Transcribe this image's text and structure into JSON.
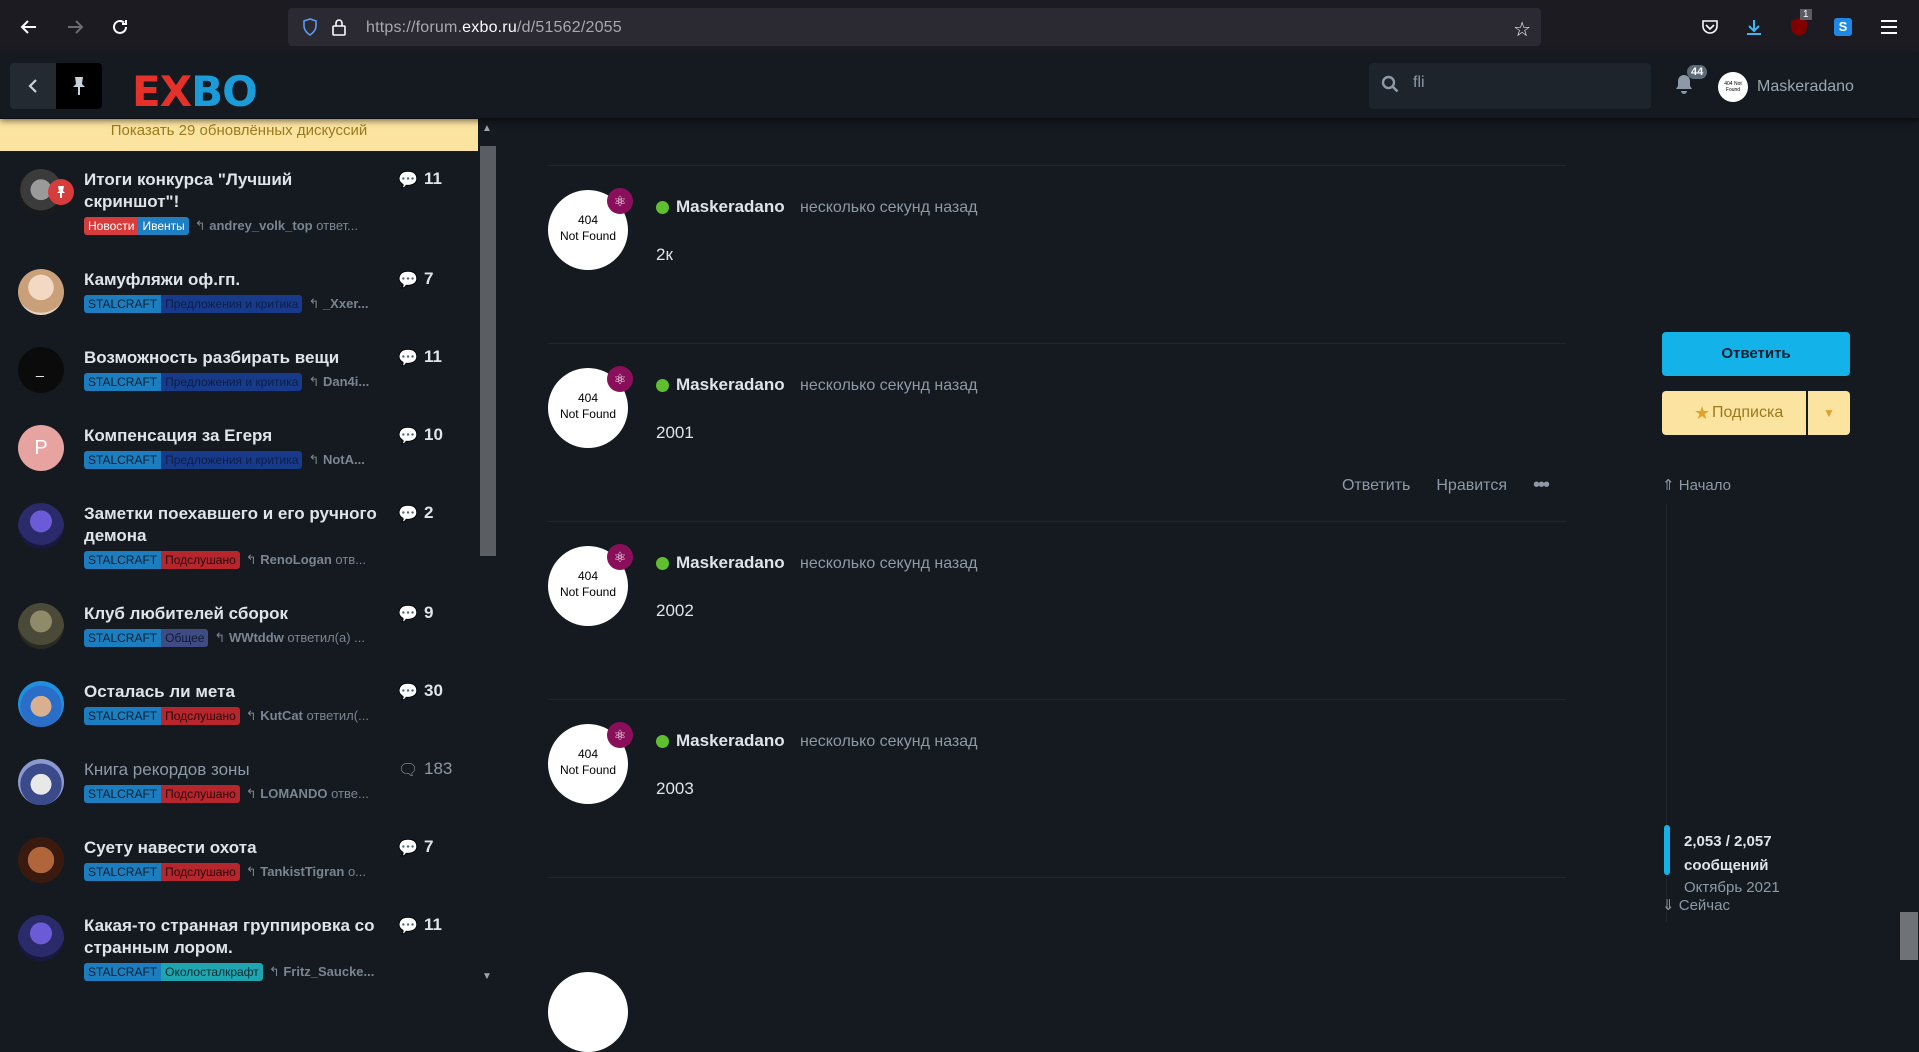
{
  "browser": {
    "url_prefix": "https://forum.",
    "url_domain": "exbo.ru",
    "url_path": "/d/51562/2055",
    "ext_badge": "1"
  },
  "header": {
    "logo_e": "E",
    "logo_x": "X",
    "logo_bo": "BO",
    "search_value": "fli",
    "notif_count": "44",
    "avatar_text": "404 Not Found",
    "username": "Maskeradano"
  },
  "sidebar": {
    "banner": "Показать 29 обновлённых дискуссий",
    "discussions": [
      {
        "title": "Итоги конкурса \"Лучший скриншот\"!",
        "count": "11",
        "tag1": "Новости",
        "tag2": "Ивенты",
        "reply_user": "andrey_volk_top",
        "reply_text": " ответ..."
      },
      {
        "title": "Камуфляжи оф.гп.",
        "count": "7",
        "tag1": "STALCRAFT",
        "tag2": "Предложения и критика",
        "reply_user": "_Xxer...",
        "reply_text": ""
      },
      {
        "title": "Возможность разбирать вещи",
        "count": "11",
        "tag1": "STALCRAFT",
        "tag2": "Предложения и критика",
        "reply_user": "Dan4i...",
        "reply_text": ""
      },
      {
        "title": "Компенсация за Егеря",
        "count": "10",
        "tag1": "STALCRAFT",
        "tag2": "Предложения и критика",
        "reply_user": "NotA...",
        "reply_text": ""
      },
      {
        "title": "Заметки поехавшего и его ручного демона",
        "count": "2",
        "tag1": "STALCRAFT",
        "tag2": "Подслушано",
        "reply_user": "RenoLogan",
        "reply_text": " отв..."
      },
      {
        "title": "Клуб любителей сборок",
        "count": "9",
        "tag1": "STALCRAFT",
        "tag2": "Общее",
        "reply_user": "WWtddw",
        "reply_text": " ответил(а) ..."
      },
      {
        "title": "Осталась ли мета",
        "count": "30",
        "tag1": "STALCRAFT",
        "tag2": "Подслушано",
        "reply_user": "KutCat",
        "reply_text": " ответил(..."
      },
      {
        "title": "Книга рекордов зоны",
        "count": "183",
        "tag1": "STALCRAFT",
        "tag2": "Подслушано",
        "reply_user": "LOMANDO",
        "reply_text": " отве..."
      },
      {
        "title": "Суету навести охота",
        "count": "7",
        "tag1": "STALCRAFT",
        "tag2": "Подслушано",
        "reply_user": "TankistTigran",
        "reply_text": " о..."
      },
      {
        "title": "Какая-то странная группировка со странным лором.",
        "count": "11",
        "tag1": "STALCRAFT",
        "tag2": "Околосталкрафт",
        "reply_user": "Fritz_Saucke...",
        "reply_text": ""
      }
    ]
  },
  "posts": [
    {
      "avatar": "404\nNot Found",
      "user": "Maskeradano",
      "time": "несколько секунд назад",
      "body": "2к"
    },
    {
      "avatar": "404\nNot Found",
      "user": "Maskeradano",
      "time": "несколько секунд назад",
      "body": "2001",
      "reply": "Ответить",
      "like": "Нравится"
    },
    {
      "avatar": "404\nNot Found",
      "user": "Maskeradano",
      "time": "несколько секунд назад",
      "body": "2002"
    },
    {
      "avatar": "404\nNot Found",
      "user": "Maskeradano",
      "time": "несколько секунд назад",
      "body": "2003"
    }
  ],
  "right": {
    "reply_button": "Ответить",
    "subscribe_button": "Подписка",
    "start": "Начало",
    "count": "2,053 / 2,057",
    "count_label": "сообщений",
    "date": "Октябрь 2021",
    "now": "Сейчас"
  },
  "colors": {
    "accent": "#13b3e9",
    "subscribe": "#fbe3a0",
    "online": "#5fbf2e",
    "background": "#141a1f"
  }
}
